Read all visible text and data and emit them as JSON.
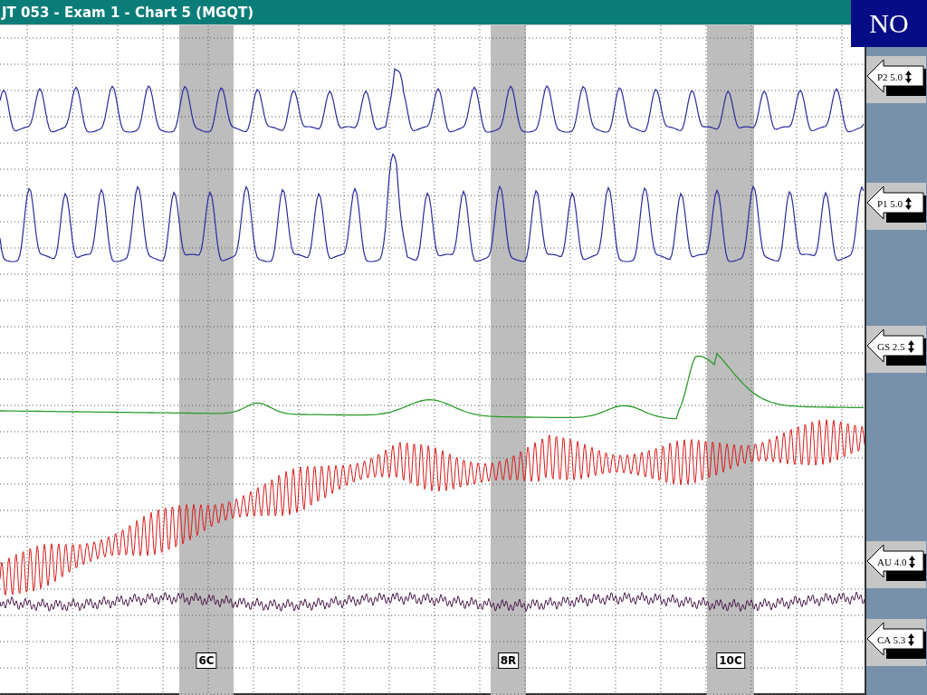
{
  "window": {
    "title": "JT 053 - Exam 1 - Chart 5 (MGQT)"
  },
  "verdict": "NO",
  "channels": [
    {
      "label": "P2",
      "value": "5.0"
    },
    {
      "label": "P1",
      "value": "5.0"
    },
    {
      "label": "GS",
      "value": "2.5"
    },
    {
      "label": "AU",
      "value": "4.0"
    },
    {
      "label": "CA",
      "value": "5.3"
    }
  ],
  "questions": [
    {
      "label": "6C"
    },
    {
      "label": "8R"
    },
    {
      "label": "10C"
    }
  ]
}
